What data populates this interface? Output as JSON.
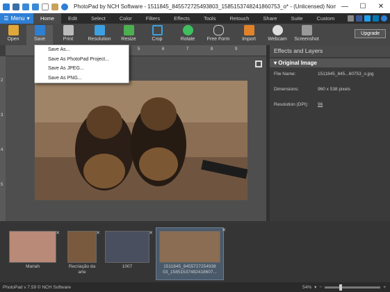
{
  "window": {
    "title": "PhotoPad by NCH Software - 1511845_845572725493803_1585153748241860753_o* - (Unlicensed) Non-commercial home use ...",
    "minimize": "—",
    "maximize": "☐",
    "close": "✕"
  },
  "menu_button": "Menu",
  "tabs": [
    "Home",
    "Edit",
    "Select",
    "Color",
    "Filters",
    "Effects",
    "Tools",
    "Retouch",
    "Share",
    "Suite",
    "Custom"
  ],
  "toolbar": {
    "open": "Open",
    "save": "Save",
    "print": "Print",
    "resolution": "Resolution",
    "resize": "Resize",
    "crop": "Crop",
    "rotate": "Rotate",
    "freeform": "Free Form",
    "import": "Import",
    "webcam": "Webcam",
    "screenshot": "Screenshot",
    "upgrade": "Upgrade"
  },
  "save_menu": [
    "Save As...",
    "Save As PhotoPad Project...",
    "Save As JPEG...",
    "Save As PNG..."
  ],
  "ruler_top_ticks": [
    "5",
    "6",
    "7",
    "8",
    "9"
  ],
  "ruler_left_ticks": [
    "2",
    "3",
    "4",
    "5"
  ],
  "panel": {
    "title": "Effects and Layers",
    "section": "Original Image",
    "file_name_label": "File Name:",
    "file_name_value": "1511845_845...60753_o.jpg",
    "dimensions_label": "Dimensions:",
    "dimensions_value": "960 x 538 pixels",
    "resolution_label": "Resolution (DPI):",
    "resolution_value": "96"
  },
  "thumbnails": [
    {
      "caption": "Mariah"
    },
    {
      "caption": "Recriação da arte"
    },
    {
      "caption": "1007"
    },
    {
      "caption": "1511845_8455727254938 03_15851537482418607..."
    }
  ],
  "status": {
    "left": "PhotoPad v 7.59 © NCH Software",
    "zoom": "54%",
    "zoom_level": 0.54
  },
  "colors": {
    "accent": "#2e7fd6",
    "dark_bg": "#3d3d3d"
  }
}
